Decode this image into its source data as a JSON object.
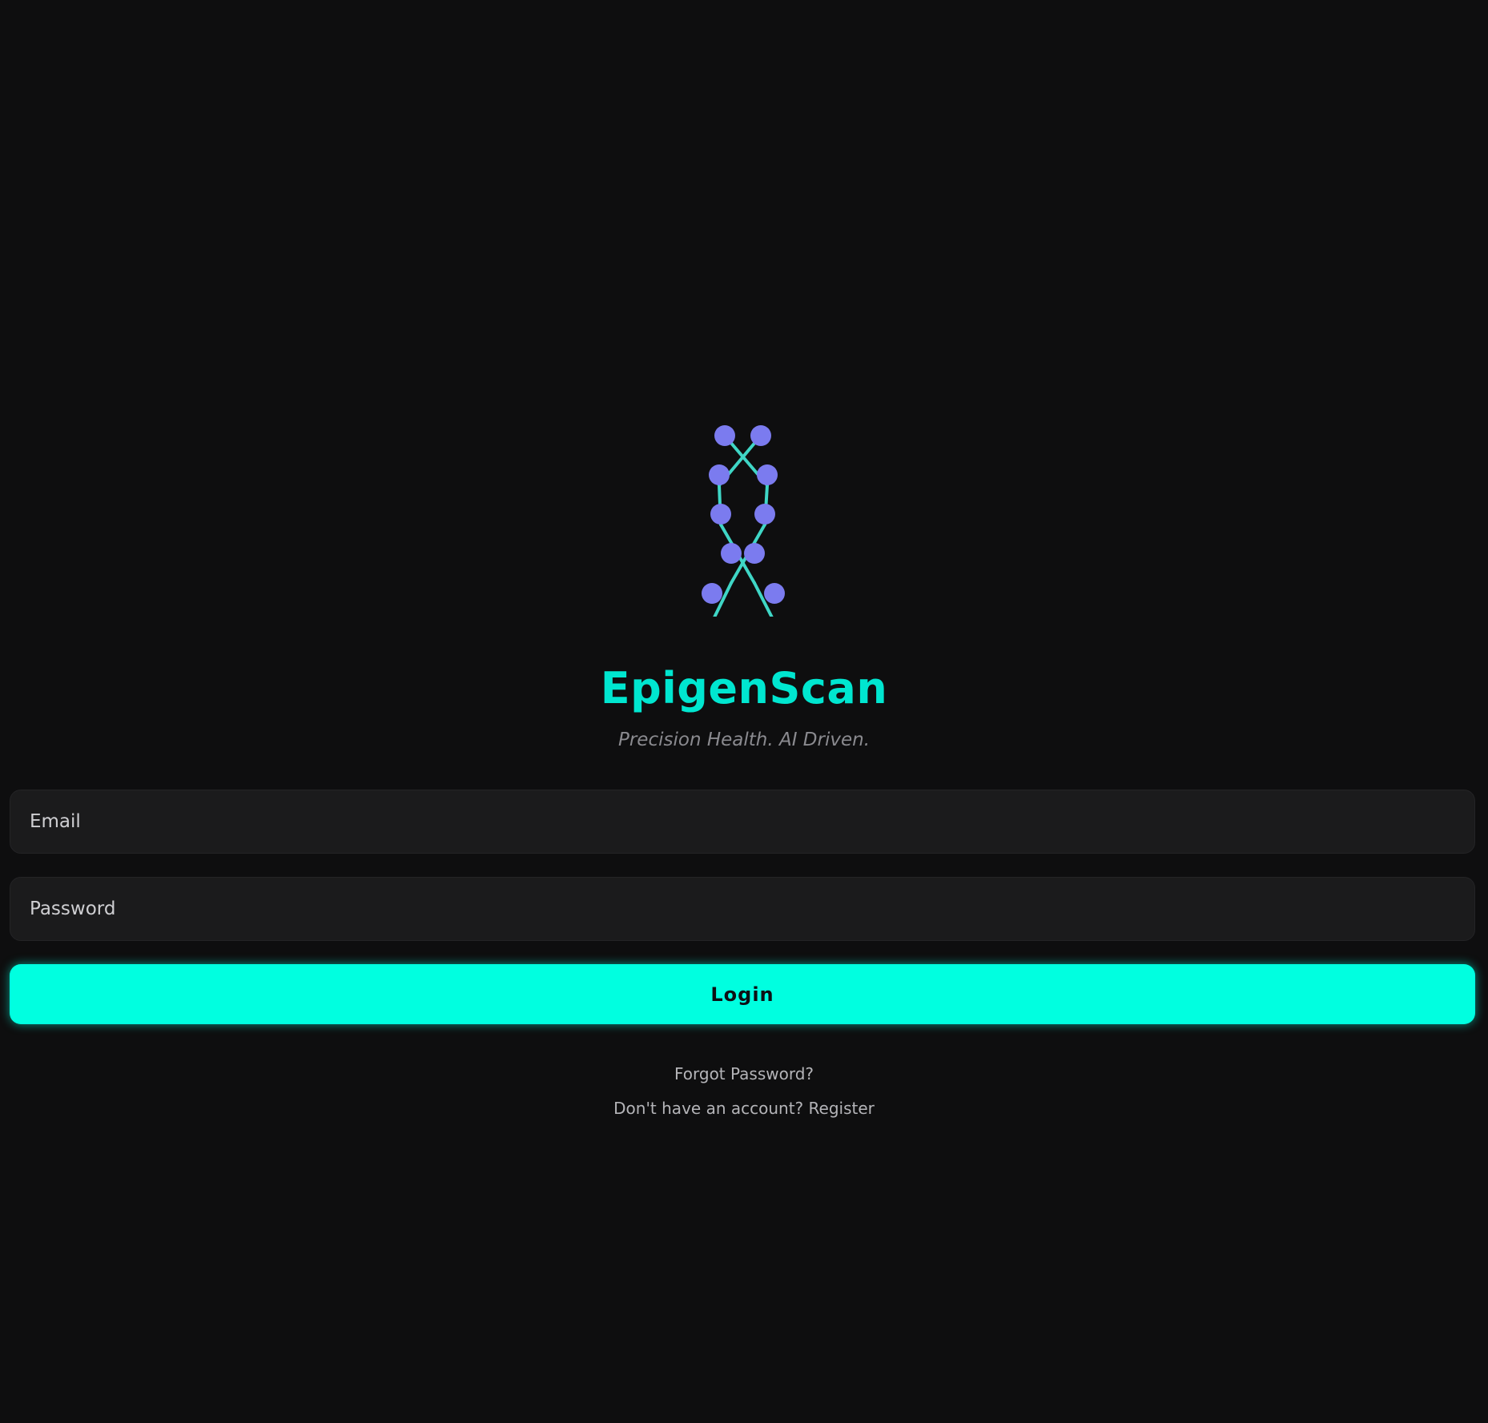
{
  "brand": {
    "logo_icon": "dna-helix-icon",
    "title": "EpigenScan",
    "tagline": "Precision Health. AI Driven."
  },
  "form": {
    "email_placeholder": "Email",
    "password_placeholder": "Password",
    "login_label": "Login"
  },
  "links": {
    "forgot_password": "Forgot Password?",
    "register_prompt": "Don't have an account?",
    "register_link": "Register"
  },
  "colors": {
    "background": "#0e0e0f",
    "accent": "#00ffe0",
    "title": "#00e6d0",
    "logo_nodes": "#7b7bef",
    "logo_links": "#3fd6c6"
  }
}
